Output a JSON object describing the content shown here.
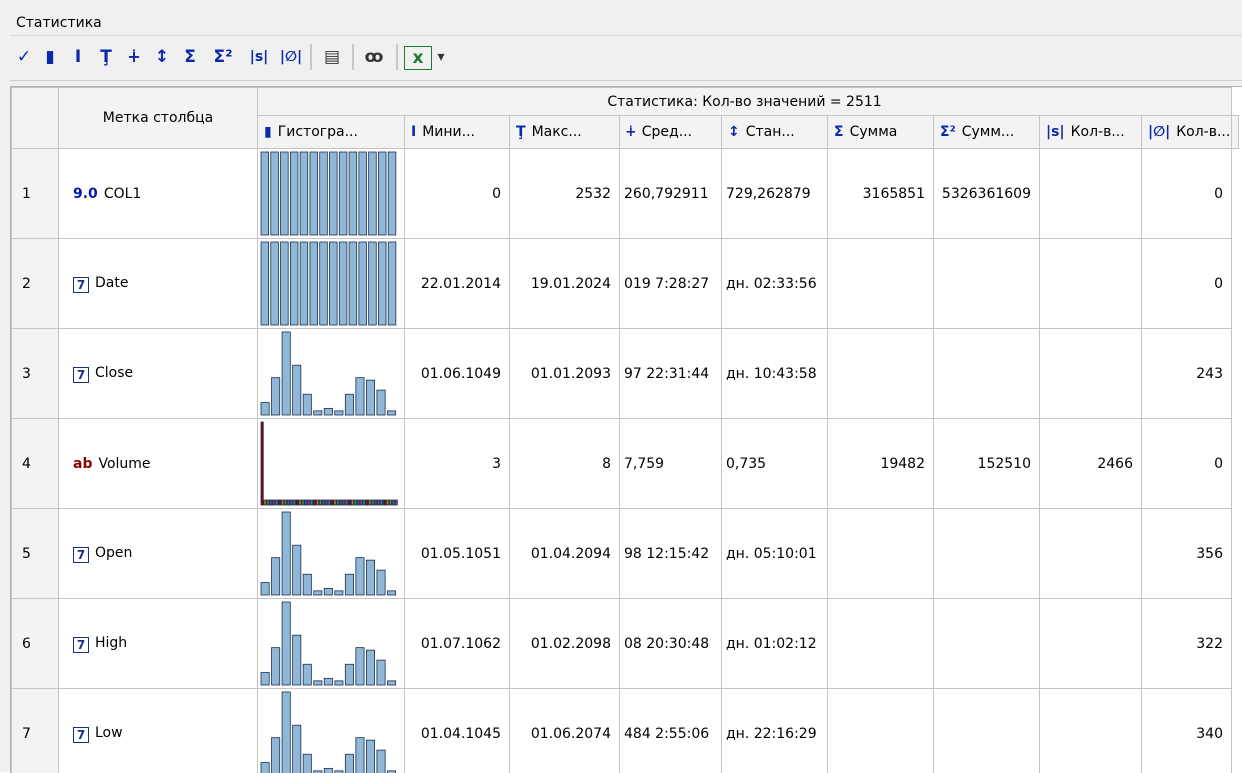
{
  "window": {
    "title": "Статистика"
  },
  "toolbar": {
    "buttons": [
      {
        "name": "check-icon",
        "glyph": "✓"
      },
      {
        "name": "histogram-icon",
        "glyph": "▮"
      },
      {
        "name": "min-icon",
        "glyph": "Ⅰ"
      },
      {
        "name": "max-icon",
        "glyph": "Ţ"
      },
      {
        "name": "mean-icon",
        "glyph": "∔"
      },
      {
        "name": "stddev-icon",
        "glyph": "↕"
      },
      {
        "name": "sum-icon",
        "glyph": "Σ"
      },
      {
        "name": "sum-squares-icon",
        "glyph": "Σ²"
      },
      {
        "name": "count-string-icon",
        "glyph": "|s|"
      },
      {
        "name": "count-null-icon",
        "glyph": "|∅|"
      },
      {
        "name": "properties-icon",
        "glyph": "▤"
      },
      {
        "name": "view-icon",
        "glyph": "ꝏ"
      },
      {
        "name": "excel-export-icon",
        "glyph": "x"
      },
      {
        "name": "dropdown-icon",
        "glyph": "▾"
      }
    ]
  },
  "grid": {
    "label_header": "Метка столбца",
    "stats_header": "Статистика: Кол-во значений = 2511",
    "columns": [
      {
        "icon": "▮",
        "label": "Гистогра..."
      },
      {
        "icon": "Ⅰ",
        "label": "Мини..."
      },
      {
        "icon": "Ţ",
        "label": "Макс..."
      },
      {
        "icon": "∔",
        "label": "Сред..."
      },
      {
        "icon": "↕",
        "label": "Стан..."
      },
      {
        "icon": "Σ",
        "label": "Сумма"
      },
      {
        "icon": "Σ²",
        "label": "Сумм..."
      },
      {
        "icon": "|s|",
        "label": "Кол-в..."
      },
      {
        "icon": "|∅|",
        "label": "Кол-в..."
      }
    ],
    "rows": [
      {
        "num": "1",
        "type": "9.0",
        "type_kind": "num",
        "label": "COL1",
        "min": "0",
        "max": "2532",
        "mean": "260,792911",
        "std": "729,262879",
        "sum": "3165851",
        "sumsq": "5326361609",
        "count_s": "",
        "count_null": "0",
        "hist": [
          1,
          1,
          1,
          1,
          1,
          1,
          1,
          1,
          1,
          1,
          1,
          1,
          1,
          1
        ]
      },
      {
        "num": "2",
        "type": "7",
        "type_kind": "date",
        "label": "Date",
        "min": "22.01.2014",
        "max": "19.01.2024",
        "mean": "019 7:28:27",
        "std": "дн. 02:33:56",
        "sum": "",
        "sumsq": "",
        "count_s": "",
        "count_null": "0",
        "hist": [
          1,
          1,
          1,
          1,
          1,
          1,
          1,
          1,
          1,
          1,
          1,
          1,
          1,
          1
        ]
      },
      {
        "num": "3",
        "type": "7",
        "type_kind": "date",
        "label": "Close",
        "min": "01.06.1049",
        "max": "01.01.2093",
        "mean": "97 22:31:44",
        "std": "дн. 10:43:58",
        "sum": "",
        "sumsq": "",
        "count_s": "",
        "count_null": "243",
        "hist": [
          0.15,
          0.45,
          1.0,
          0.6,
          0.25,
          0.05,
          0.08,
          0.05,
          0.25,
          0.45,
          0.42,
          0.3,
          0.05
        ]
      },
      {
        "num": "4",
        "type": "ab",
        "type_kind": "str",
        "label": "Volume",
        "min": "3",
        "max": "8",
        "mean": "7,759",
        "std": "0,735",
        "sum": "19482",
        "sumsq": "152510",
        "count_s": "2466",
        "count_null": "0",
        "hist": [
          1,
          0.06,
          0.06,
          0.06,
          0.06,
          0.06,
          0.06,
          0.06,
          0.06,
          0.06,
          0.06,
          0.06,
          0.06,
          0.06,
          0.06,
          0.06,
          0.06,
          0.06,
          0.06,
          0.06,
          0.06,
          0.06,
          0.06,
          0.06,
          0.06,
          0.06,
          0.06,
          0.06,
          0.06,
          0.06,
          0.06,
          0.06,
          0.06,
          0.06,
          0.06,
          0.06,
          0.06,
          0.06,
          0.06,
          0.06,
          0.06,
          0.06,
          0.06,
          0.06,
          0.06,
          0.06,
          0.06
        ]
      },
      {
        "num": "5",
        "type": "7",
        "type_kind": "date",
        "label": "Open",
        "min": "01.05.1051",
        "max": "01.04.2094",
        "mean": "98 12:15:42",
        "std": "дн. 05:10:01",
        "sum": "",
        "sumsq": "",
        "count_s": "",
        "count_null": "356",
        "hist": [
          0.15,
          0.45,
          1.0,
          0.6,
          0.25,
          0.05,
          0.08,
          0.05,
          0.25,
          0.45,
          0.42,
          0.3,
          0.05
        ]
      },
      {
        "num": "6",
        "type": "7",
        "type_kind": "date",
        "label": "High",
        "min": "01.07.1062",
        "max": "01.02.2098",
        "mean": "08 20:30:48",
        "std": "дн. 01:02:12",
        "sum": "",
        "sumsq": "",
        "count_s": "",
        "count_null": "322",
        "hist": [
          0.15,
          0.45,
          1.0,
          0.6,
          0.25,
          0.05,
          0.08,
          0.05,
          0.25,
          0.45,
          0.42,
          0.3,
          0.05
        ]
      },
      {
        "num": "7",
        "type": "7",
        "type_kind": "date",
        "label": "Low",
        "min": "01.04.1045",
        "max": "01.06.2074",
        "mean": "484 2:55:06",
        "std": "дн. 22:16:29",
        "sum": "",
        "sumsq": "",
        "count_s": "",
        "count_null": "340",
        "hist": [
          0.15,
          0.45,
          1.0,
          0.6,
          0.25,
          0.05,
          0.08,
          0.05,
          0.25,
          0.45,
          0.42,
          0.3,
          0.05
        ]
      }
    ]
  },
  "colors": {
    "bar": "#8fb8d8",
    "bar_stroke": "#1d2d4d",
    "volume_first": "#8a0000"
  }
}
